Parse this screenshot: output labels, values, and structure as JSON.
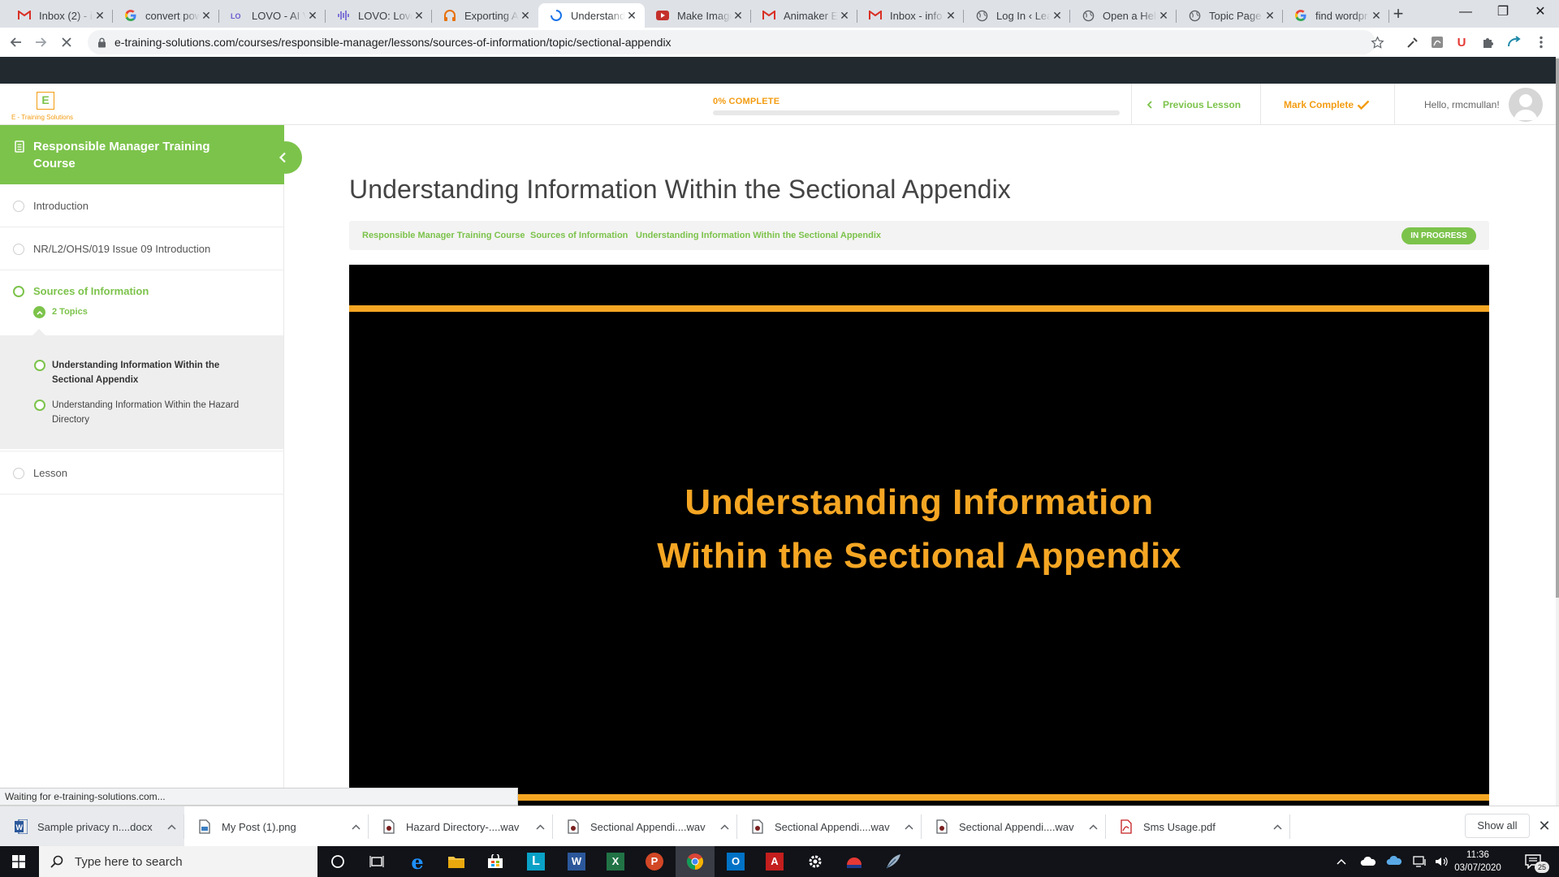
{
  "browser": {
    "tabs": [
      {
        "title": "Inbox (2) - in",
        "icon": "gmail"
      },
      {
        "title": "convert pow",
        "icon": "google"
      },
      {
        "title": "LOVO - AI Vo",
        "icon": "lovo"
      },
      {
        "title": "LOVO: Love",
        "icon": "lovo-wave"
      },
      {
        "title": "Exporting Au",
        "icon": "headphones"
      },
      {
        "title": "Understandi",
        "icon": "loading",
        "active": true
      },
      {
        "title": "Make Image",
        "icon": "youtube"
      },
      {
        "title": "Animaker Er",
        "icon": "gmail"
      },
      {
        "title": "Inbox - info",
        "icon": "gmail"
      },
      {
        "title": "Log In ‹ Lear",
        "icon": "globe"
      },
      {
        "title": "Open a Help",
        "icon": "globe"
      },
      {
        "title": "Topic Page C",
        "icon": "globe"
      },
      {
        "title": "find wordpr",
        "icon": "google"
      }
    ],
    "url": "e-training-solutions.com/courses/responsible-manager/lessons/sources-of-information/topic/sectional-appendix",
    "status_text": "Waiting for e-training-solutions.com..."
  },
  "header": {
    "logo_letter": "E",
    "logo_text": "E - Training Solutions",
    "progress_label": "0% COMPLETE",
    "progress_percent": 0,
    "prev_lesson": "Previous Lesson",
    "mark_complete": "Mark Complete",
    "greeting": "Hello, rmcmullan!"
  },
  "sidebar": {
    "course_title": "Responsible Manager Training Course",
    "items": [
      {
        "label": "Introduction"
      },
      {
        "label": "NR/L2/OHS/019 Issue 09 Introduction"
      },
      {
        "label": "Sources of Information",
        "topics_label": "2 Topics"
      },
      {
        "label": "Lesson"
      }
    ],
    "topics": [
      {
        "label": "Understanding Information Within the Sectional Appendix",
        "current": true
      },
      {
        "label": "Understanding Information Within the Hazard Directory"
      }
    ]
  },
  "main": {
    "title": "Understanding Information Within the Sectional Appendix",
    "breadcrumbs": [
      "Responsible Manager Training Course",
      "Sources of Information",
      "Understanding Information Within the Sectional Appendix"
    ],
    "status": "IN PROGRESS",
    "video_title_line1": "Understanding Information",
    "video_title_line2": "Within the Sectional Appendix"
  },
  "downloads": {
    "items": [
      {
        "name": "Sample privacy n....docx",
        "type": "word"
      },
      {
        "name": "My Post (1).png",
        "type": "image"
      },
      {
        "name": "Hazard Directory-....wav",
        "type": "audio"
      },
      {
        "name": "Sectional Appendi....wav",
        "type": "audio"
      },
      {
        "name": "Sectional Appendi....wav",
        "type": "audio"
      },
      {
        "name": "Sectional Appendi....wav",
        "type": "audio"
      },
      {
        "name": "Sms Usage.pdf",
        "type": "pdf"
      }
    ],
    "show_all": "Show all"
  },
  "taskbar": {
    "search_placeholder": "Type here to search",
    "time": "11:36",
    "date": "03/07/2020",
    "notification_count": "25"
  },
  "colors": {
    "accent_green": "#7cc34b",
    "accent_orange": "#f39c12",
    "video_orange": "#f5a623"
  }
}
